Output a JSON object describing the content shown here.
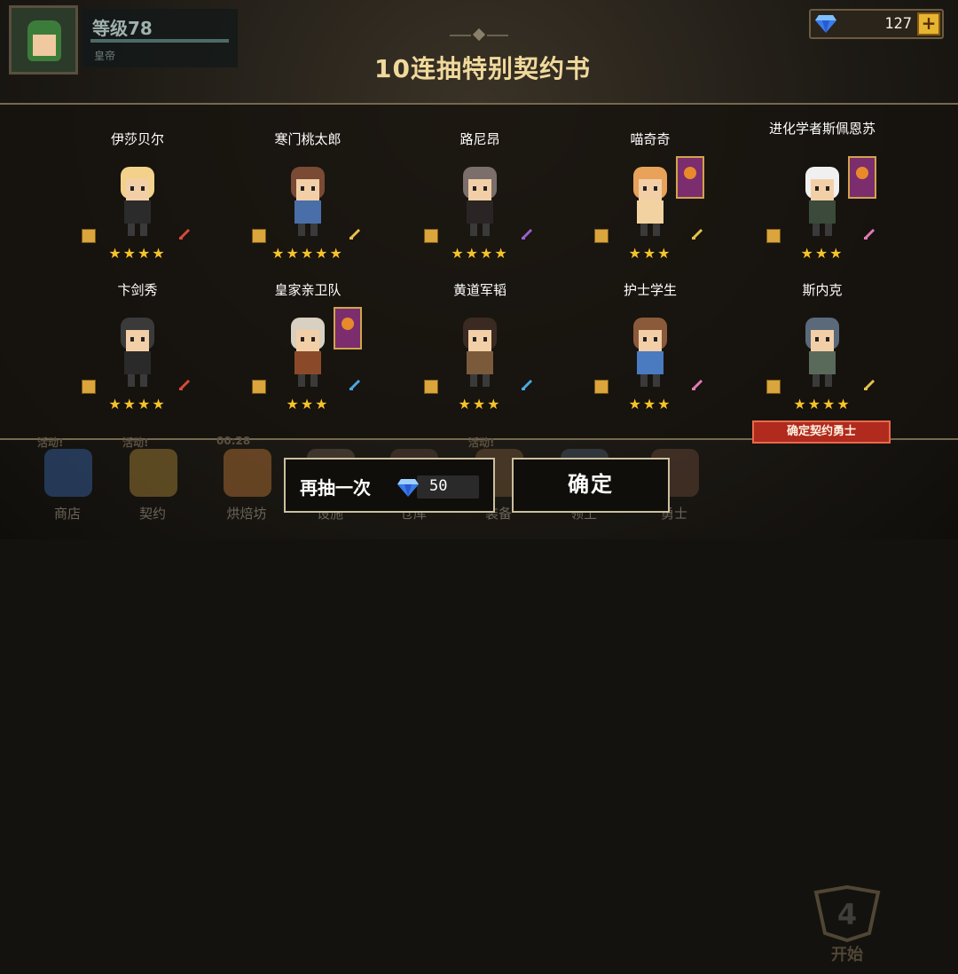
{
  "player": {
    "level_label": "等级78",
    "sub_label": "皇帝"
  },
  "currency": {
    "gems": "127",
    "plus_label": "+"
  },
  "title": "10连抽特别契约书",
  "cards": [
    {
      "name": "伊莎贝尔",
      "stars": "★★★★",
      "weapon_icon": "sword-icon",
      "weapon_color": "#d84a3a",
      "banner": false,
      "hair": "#f2d28a",
      "body": "#2b2b2b"
    },
    {
      "name": "寒门桃太郎",
      "stars": "★★★★★",
      "weapon_icon": "sword-icon",
      "weapon_color": "#e6c14a",
      "banner": false,
      "hair": "#7a4a34",
      "body": "#4a6ea8"
    },
    {
      "name": "路尼昂",
      "stars": "★★★★",
      "weapon_icon": "staff-icon",
      "weapon_color": "#9a5fd0",
      "banner": false,
      "hair": "#7a6f6a",
      "body": "#2a2424"
    },
    {
      "name": "喵奇奇",
      "stars": "★★★",
      "weapon_icon": "sword-icon",
      "weapon_color": "#e6c14a",
      "banner": true,
      "hair": "#e8a25a",
      "body": "#f2d2a0"
    },
    {
      "name": "进化学者斯佩恩苏",
      "stars": "★★★",
      "weapon_icon": "potion-icon",
      "weapon_color": "#e07ab4",
      "banner": true,
      "hair": "#f0f0f0",
      "body": "#3b4a3a"
    },
    {
      "name": "卞剑秀",
      "stars": "★★★★",
      "weapon_icon": "sword-icon",
      "weapon_color": "#d84a3a",
      "banner": false,
      "hair": "#3a3a3a",
      "body": "#2a2a2a"
    },
    {
      "name": "皇家亲卫队",
      "stars": "★★★",
      "weapon_icon": "axe-icon",
      "weapon_color": "#4aa8e0",
      "banner": true,
      "hair": "#d8d0c0",
      "body": "#8a4a2a"
    },
    {
      "name": "黄道军韬",
      "stars": "★★★",
      "weapon_icon": "axe-icon",
      "weapon_color": "#4aa8e0",
      "banner": false,
      "hair": "#3a2a22",
      "body": "#7a5a3a"
    },
    {
      "name": "护士学生",
      "stars": "★★★",
      "weapon_icon": "potion-icon",
      "weapon_color": "#e07ab4",
      "banner": false,
      "hair": "#8a5a3a",
      "body": "#4a7ac0"
    },
    {
      "name": "斯内克",
      "stars": "★★★★",
      "weapon_icon": "sword-icon",
      "weapon_color": "#e6c14a",
      "banner": false,
      "hair": "#5a6a7a",
      "body": "#5a6a5a"
    }
  ],
  "confirm_tag": "确定契约勇士",
  "nav": [
    {
      "label": "商店",
      "badge": "活动!"
    },
    {
      "label": "契约",
      "badge": "活动!"
    },
    {
      "label": "烘焙坊",
      "badge": "00:28"
    },
    {
      "label": "设施",
      "badge": ""
    },
    {
      "label": "仓库",
      "badge": ""
    },
    {
      "label": "装备",
      "badge": "活动!"
    },
    {
      "label": "领土",
      "badge": ""
    },
    {
      "label": "勇士",
      "badge": ""
    }
  ],
  "start_label": "开始",
  "buttons": {
    "again_label": "再抽一次",
    "again_cost": "50",
    "ok_label": "确定"
  }
}
